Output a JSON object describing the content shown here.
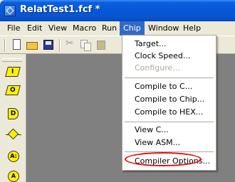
{
  "window": {
    "title": "RelatTest1.fcf *"
  },
  "menubar": {
    "items": [
      "File",
      "Edit",
      "View",
      "Macro",
      "Run",
      "Chip",
      "Window",
      "Help"
    ],
    "active": "Chip"
  },
  "toolbar": {
    "buttons": [
      "new-file-icon",
      "open-folder-icon",
      "save-disk-icon",
      "cut-icon",
      "copy-icon",
      "paste-icon"
    ]
  },
  "palette": {
    "items": [
      {
        "icon": "input-parallelogram-icon",
        "glyph": "I"
      },
      {
        "icon": "output-parallelogram-icon",
        "glyph": "O"
      },
      {
        "icon": "delay-box-icon",
        "glyph": "D"
      },
      {
        "icon": "decision-diamond-icon",
        "glyph": ""
      },
      {
        "icon": "assignment-circle-icon",
        "glyph": "A:"
      },
      {
        "icon": "a-circle-icon",
        "glyph": "A"
      }
    ]
  },
  "chip_menu": {
    "items": [
      {
        "label": "Target...",
        "enabled": true
      },
      {
        "label": "Clock Speed...",
        "enabled": true
      },
      {
        "label": "Configure...",
        "enabled": false
      },
      {
        "label": "Compile to C...",
        "enabled": true
      },
      {
        "label": "Compile to Chip...",
        "enabled": true
      },
      {
        "label": "Compile to HEX...",
        "enabled": true
      },
      {
        "label": "View C...",
        "enabled": true
      },
      {
        "label": "View ASM...",
        "enabled": true
      },
      {
        "label": "Compiler Options...",
        "enabled": true,
        "annotated": true
      }
    ]
  },
  "colors": {
    "title_bar": "#0758d6",
    "menu_highlight": "#316ac5",
    "annotation_oval": "#e01010",
    "palette_shape_fill": "#fff200",
    "workspace": "#808080"
  }
}
